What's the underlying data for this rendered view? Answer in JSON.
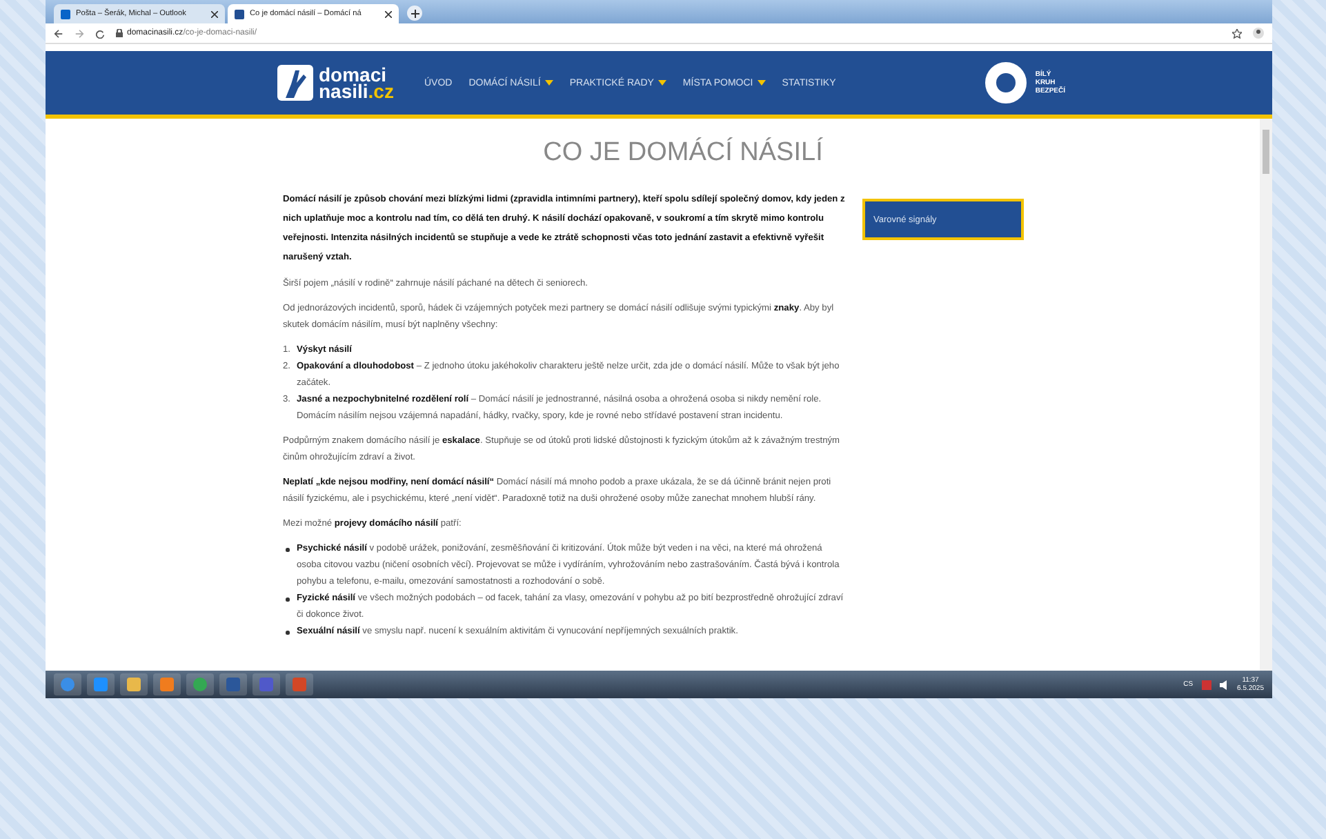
{
  "browser": {
    "tabs": [
      {
        "title": "Pošta – Šerák, Michal – Outlook",
        "selected": false
      },
      {
        "title": "Co je domácí násilí – Domácí ná",
        "selected": true
      }
    ],
    "url": {
      "domain": "domacinasili.cz",
      "path": "/co-je-domaci-nasili/"
    }
  },
  "site": {
    "logo": {
      "line1": "domaci",
      "line2": "nasili",
      "tld": ".cz"
    },
    "nav": [
      {
        "label": "ÚVOD",
        "dropdown": false
      },
      {
        "label": "DOMÁCÍ NÁSILÍ",
        "dropdown": true
      },
      {
        "label": "PRAKTICKÉ RADY",
        "dropdown": true
      },
      {
        "label": "MÍSTA POMOCI",
        "dropdown": true
      },
      {
        "label": "STATISTIKY",
        "dropdown": false
      }
    ],
    "partner": [
      "BÍLÝ",
      "KRUH",
      "BEZPEČÍ"
    ]
  },
  "article": {
    "title": "CO JE DOMÁCÍ NÁSILÍ",
    "blocks": [
      {
        "kind": "lead",
        "text": "Domácí násilí je způsob chování mezi blízkými lidmi (zpravidla intimními partnery), kteří spolu sdílejí společný domov, kdy jeden z nich uplatňuje moc a kontrolu nad tím, co dělá ten druhý. K násilí dochází opakovaně, v soukromí a tím skrytě mimo kontrolu veřejnosti. Intenzita násilných incidentů se stupňuje a vede ke ztrátě schopnosti včas toto jednání zastavit a efektivně vyřešit narušený vztah."
      },
      {
        "kind": "p",
        "text": "Širší pojem „násilí v rodině“ zahrnuje násilí páchané na dětech či seniorech."
      },
      {
        "kind": "p",
        "text": "Od jednorázových incidentů, sporů, hádek či vzájemných potyček mezi partnery se domácí násilí odlišuje svými typickými **znaky**. Aby byl skutek domácím násilím, musí být naplněny všechny:"
      },
      {
        "kind": "ol",
        "numbers": [
          "1.",
          "2.",
          "3."
        ],
        "items": [
          "**Výskyt násilí**",
          "**Opakování a dlouhodobost** – Z jednoho útoku jakéhokoliv charakteru ještě nelze určit, zda jde o domácí násilí. Může to však být jeho začátek.",
          "**Jasné a nezpochybnitelné rozdělení rolí** – Domácí násilí je jednostranné, násilná osoba a ohrožená osoba si nikdy nemění role. Domácím násilím nejsou vzájemná napadání, hádky, rvačky, spory, kde je rovné nebo střídavé postavení stran incidentu."
        ]
      },
      {
        "kind": "p",
        "text": "Podpůrným znakem domácího násilí je **eskalace**. Stupňuje se od útoků proti lidské důstojnosti k fyzickým útokům až k závažným trestným činům ohrožujícím zdraví a život."
      },
      {
        "kind": "p",
        "text": "**Neplatí „kde nejsou modřiny, není domácí násilí“** Domácí násilí má mnoho podob a praxe ukázala, že se dá účinně bránit nejen proti násilí fyzickému, ale i psychickému, které „není vidět“. Paradoxně totiž na duši ohrožené osoby může zanechat mnohem hlubší rány."
      },
      {
        "kind": "p",
        "text": "Mezi možné **projevy domácího násilí** patří:"
      },
      {
        "kind": "ul",
        "items": [
          "**Psychické násilí** v podobě urážek, ponižování, zesměšňování či kritizování. Útok může být veden i na věci, na které má ohrožená osoba citovou vazbu (ničení osobních věcí). Projevovat se může i vydíráním, vyhrožováním nebo zastrašováním. Častá bývá i kontrola pohybu a telefonu, e-mailu, omezování samostatnosti a rozhodování o sobě.",
          "**Fyzické násilí** ve všech možných podobách – od facek, tahání za vlasy, omezování v pohybu až po bití bezprostředně ohrožující zdraví či dokonce život.",
          "**Sexuální násilí** ve smyslu např. nucení k sexuálním aktivitám či vynucování nepříjemných sexuálních praktik."
        ]
      }
    ]
  },
  "sidebar": {
    "links": [
      "Varovné signály"
    ]
  },
  "taskbar": {
    "language": "CS",
    "time": "11:37",
    "date": "6.5.2025"
  }
}
